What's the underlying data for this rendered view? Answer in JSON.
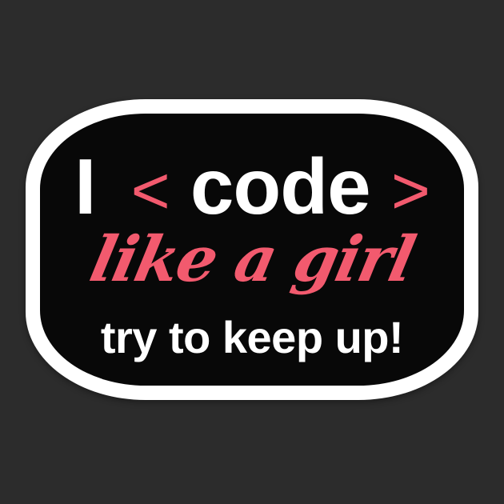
{
  "sticker": {
    "line1": {
      "pronoun": "I",
      "open_bracket": "<",
      "word": "code",
      "close_bracket": ">"
    },
    "line2": "like a girl",
    "line3": "try to keep up!"
  },
  "colors": {
    "background": "#2c2c2c",
    "sticker_border": "#ffffff",
    "sticker_fill": "#080808",
    "accent_pink": "#f25a6e",
    "text_white": "#ffffff"
  }
}
